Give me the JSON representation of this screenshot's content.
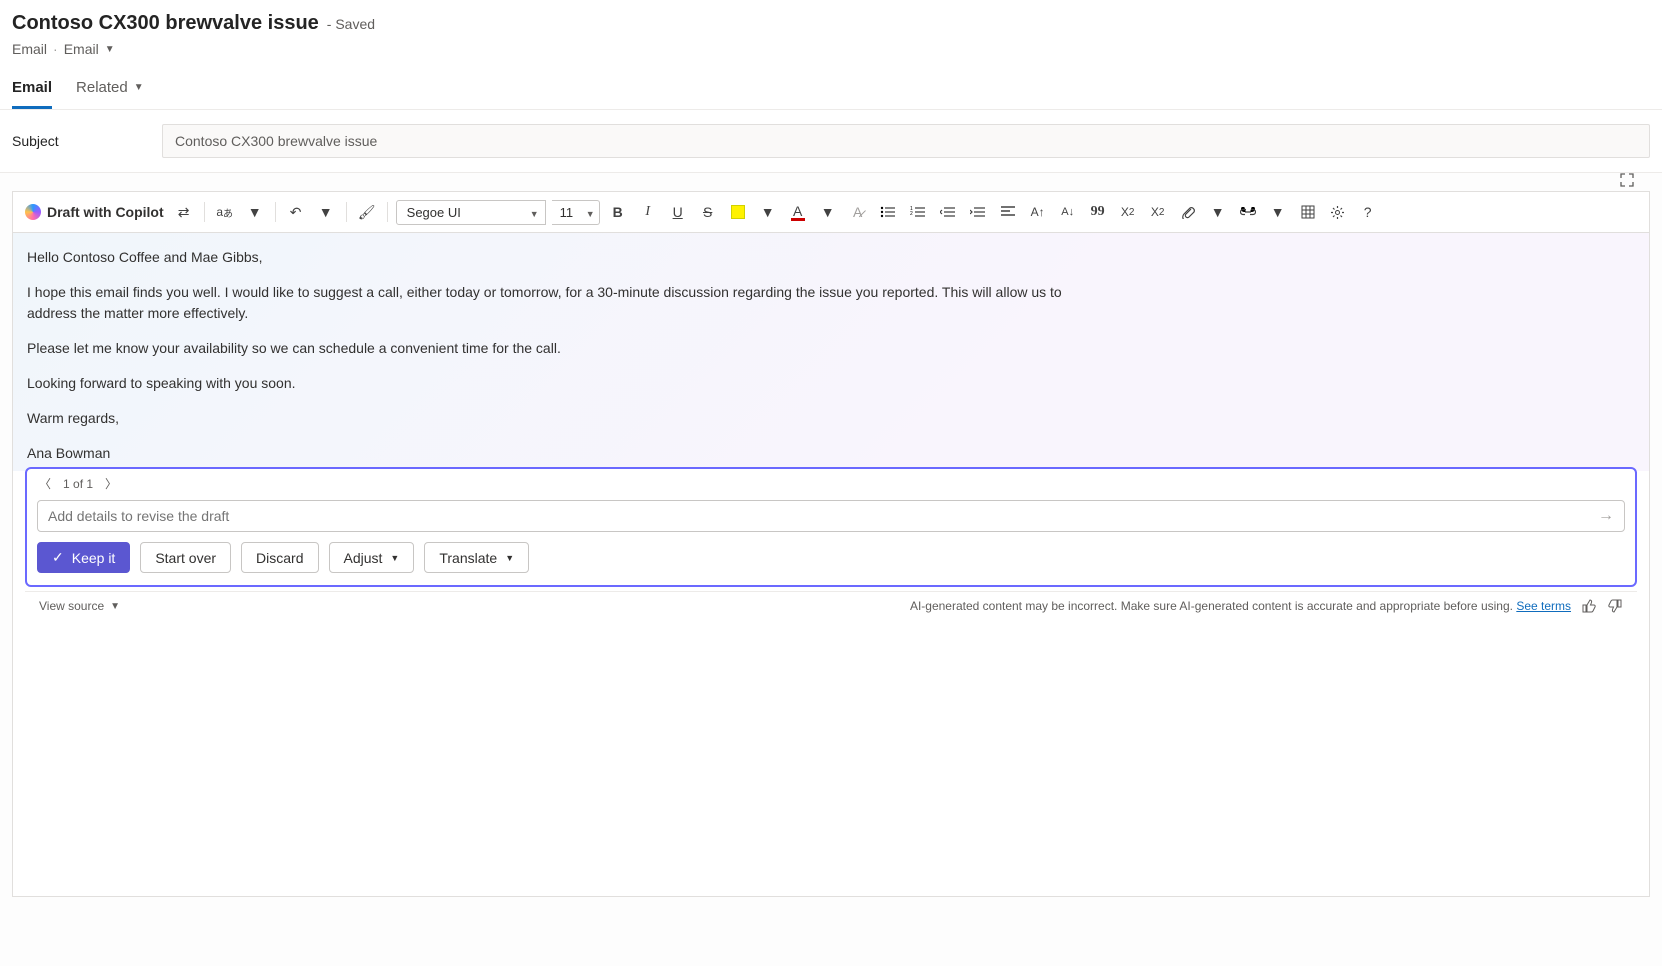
{
  "header": {
    "title": "Contoso CX300 brewvalve issue",
    "saved": "- Saved",
    "crumb1": "Email",
    "crumb2": "Email"
  },
  "tabs": {
    "email": "Email",
    "related": "Related"
  },
  "subject": {
    "label": "Subject",
    "value": "Contoso CX300 brewvalve issue"
  },
  "toolbar": {
    "copilot": "Draft with Copilot",
    "font": "Segoe UI",
    "size": "11"
  },
  "body": {
    "p1": "Hello Contoso Coffee and Mae Gibbs,",
    "p2": "I hope this email finds you well. I would like to suggest a call, either today or tomorrow, for a 30-minute discussion regarding the issue you reported. This will allow us to address the matter more effectively.",
    "p3": "Please let me know your availability so we can schedule a convenient time for the call.",
    "p4": "Looking forward to speaking with you soon.",
    "p5": "Warm regards,",
    "p6": "Ana Bowman"
  },
  "copilot": {
    "nav": "1 of 1",
    "placeholder": "Add details to revise the draft",
    "keep": "Keep it",
    "start_over": "Start over",
    "discard": "Discard",
    "adjust": "Adjust",
    "translate": "Translate"
  },
  "footer": {
    "view_source": "View source",
    "disclaimer": "AI-generated content may be incorrect. Make sure AI-generated content is accurate and appropriate before using.",
    "terms": "See terms"
  }
}
